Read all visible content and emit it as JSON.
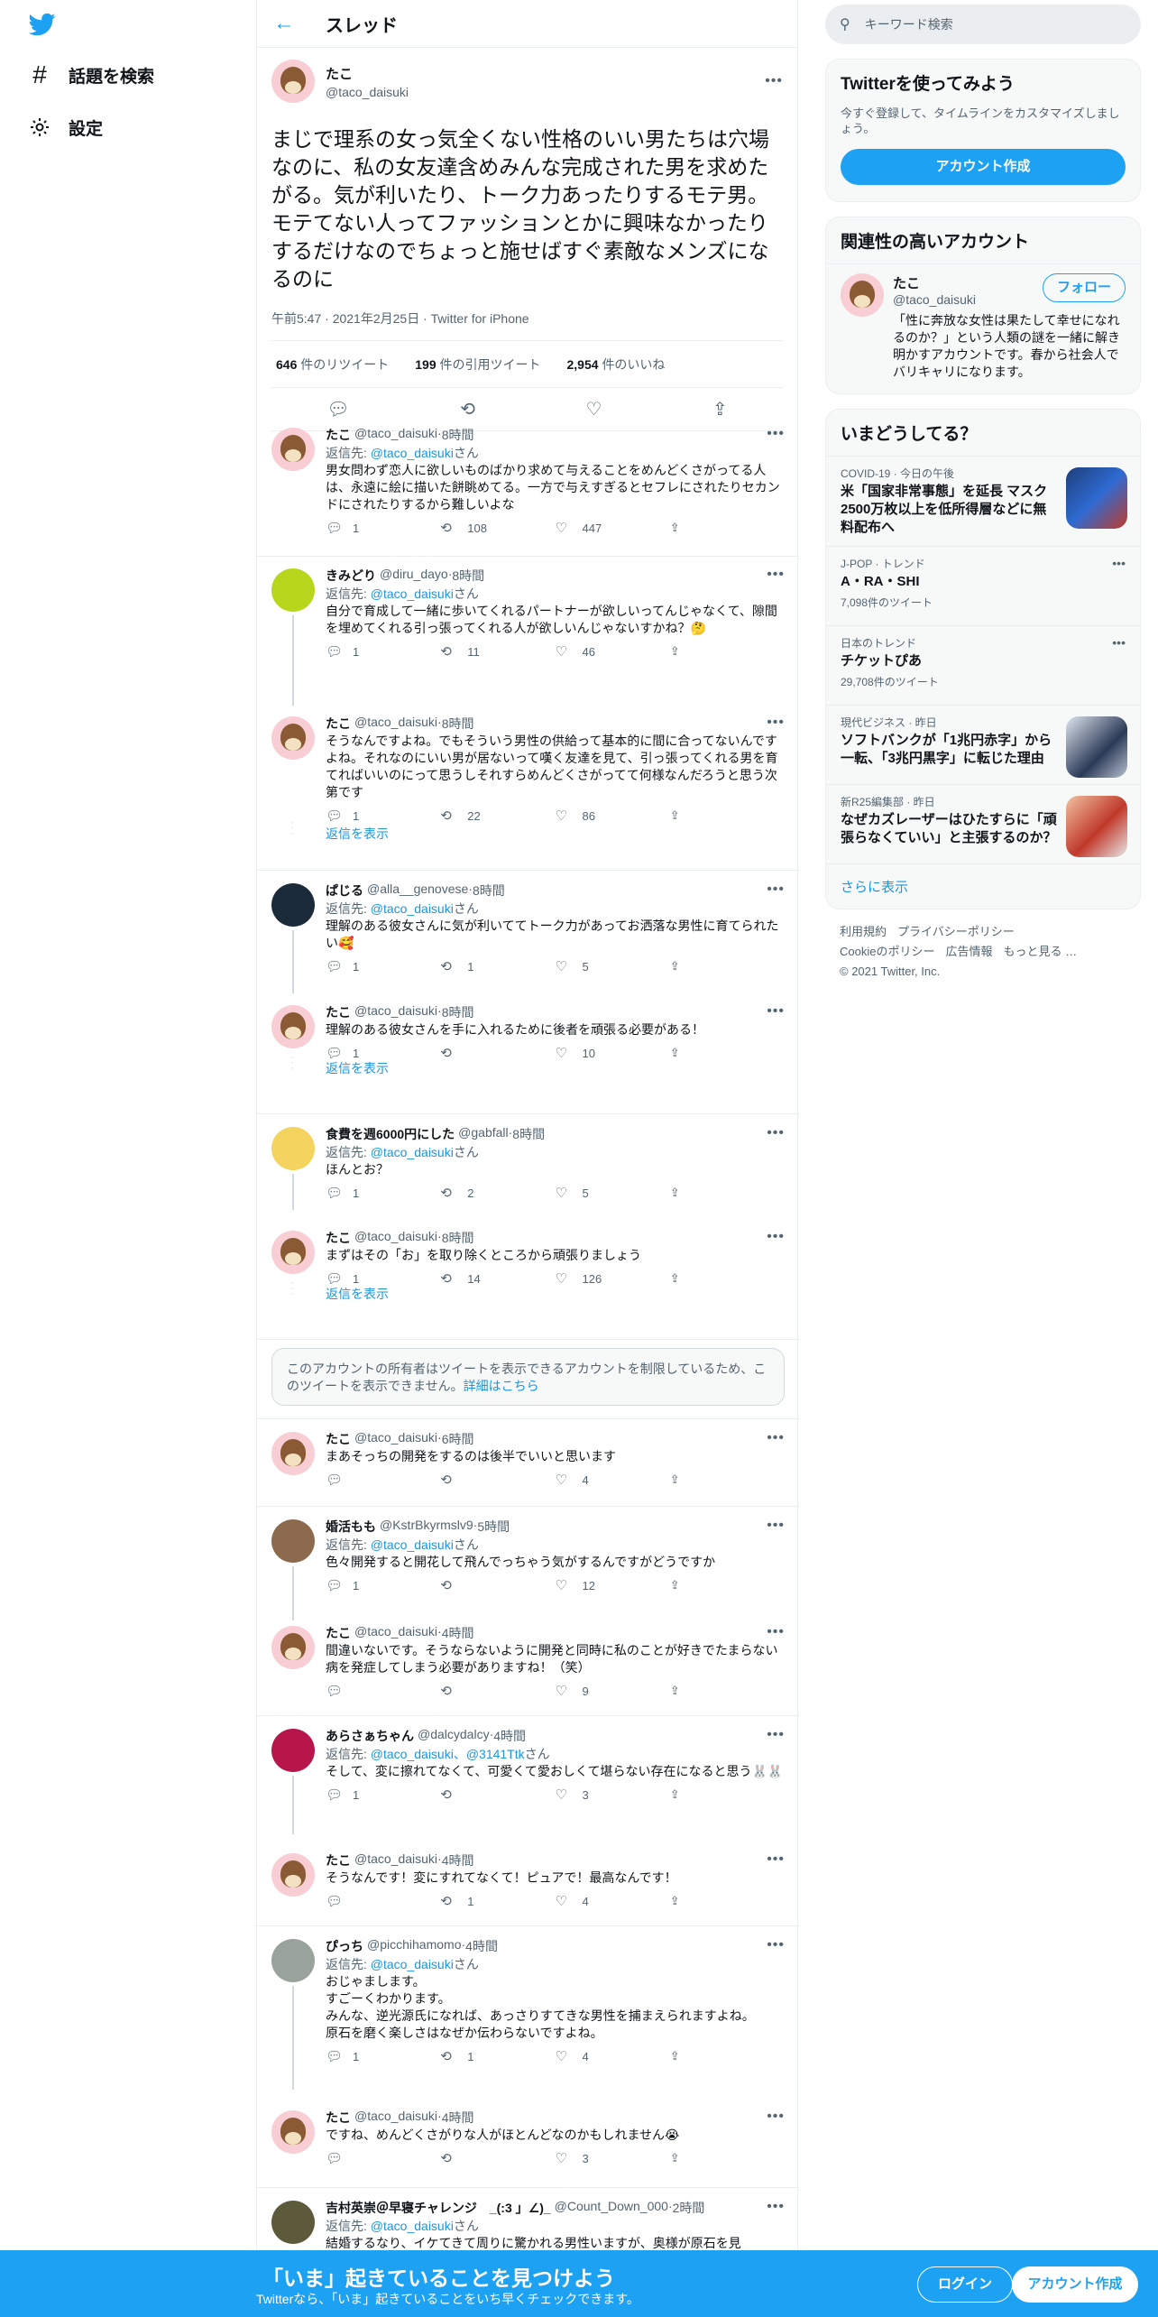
{
  "nav": {
    "explore": "話題を検索",
    "settings": "設定"
  },
  "header": {
    "title": "スレッド"
  },
  "main_tweet": {
    "name": "たこ",
    "handle": "@taco_daisuki",
    "text": "まじで理系の女っ気全くない性格のいい男たちは穴場なのに、私の女友達含めみんな完成された男を求めたがる。気が利いたり、トーク力あったりするモテ男。モテてない人ってファッションとかに興味なかったりするだけなのでちょっと施せばすぐ素敵なメンズになるのに",
    "time": "午前5:47 · 2021年2月25日 · Twitter for iPhone",
    "retweets": "646",
    "retweets_label": "件のリツイート",
    "quotes": "199",
    "quotes_label": "件の引用ツイート",
    "likes": "2,954",
    "likes_label": "件のいいね"
  },
  "replies": [
    {
      "name": "たこ",
      "handle": "@taco_daisuki",
      "time": "8時間",
      "to": "@taco_daisuki",
      "text": "男女問わず恋人に欲しいものばかり求めて与えることをめんどくさがってる人は、永遠に絵に描いた餅眺めてる。一方で与えすぎるとセフレにされたりセカンドにされたりするから難しいよな",
      "reply": "1",
      "rt": "108",
      "like": "447"
    },
    {
      "name": "きみどり",
      "handle": "@diru_dayo",
      "time": "8時間",
      "to": "@taco_daisuki",
      "text": "自分で育成して一緒に歩いてくれるパートナーが欲しいってんじゃなくて、隙間を埋めてくれる引っ張ってくれる人が欲しいんじゃないすかね？🤔",
      "reply": "1",
      "rt": "11",
      "like": "46"
    },
    {
      "name": "たこ",
      "handle": "@taco_daisuki",
      "time": "8時間",
      "to": "",
      "text": "そうなんですよね。でもそういう男性の供給って基本的に間に合ってないんですよね。それなのにいい男が居ないって嘆く友達を見て、引っ張ってくれる男を育てればいいのにって思うしそれすらめんどくさがってて何様なんだろうと思う次第です",
      "reply": "1",
      "rt": "22",
      "like": "86"
    },
    {
      "name": "ぱじる",
      "handle": "@alla__genovese",
      "time": "8時間",
      "to": "@taco_daisuki",
      "text": "理解のある彼女さんに気が利いててトーク力があってお洒落な男性に育てられたい🥰",
      "reply": "1",
      "rt": "1",
      "like": "5"
    },
    {
      "name": "たこ",
      "handle": "@taco_daisuki",
      "time": "8時間",
      "to": "",
      "text": "理解のある彼女さんを手に入れるために後者を頑張る必要がある！",
      "reply": "1",
      "rt": "",
      "like": "10"
    },
    {
      "name": "食費を週6000円にした",
      "handle": "@gabfall",
      "time": "8時間",
      "to": "@taco_daisuki",
      "text": "ほんとお？",
      "reply": "1",
      "rt": "2",
      "like": "5"
    },
    {
      "name": "たこ",
      "handle": "@taco_daisuki",
      "time": "8時間",
      "to": "",
      "text": "まずはその「お」を取り除くところから頑張りましょう",
      "reply": "1",
      "rt": "14",
      "like": "126"
    },
    {
      "name": "たこ",
      "handle": "@taco_daisuki",
      "time": "6時間",
      "to": "",
      "text": "まあそっちの開発をするのは後半でいいと思います",
      "reply": "",
      "rt": "",
      "like": "4"
    },
    {
      "name": "婚活もも",
      "handle": "@KstrBkyrmslv9",
      "time": "5時間",
      "to": "@taco_daisuki",
      "text": "色々開発すると開花して飛んでっちゃう気がするんですがどうですか",
      "reply": "1",
      "rt": "",
      "like": "12"
    },
    {
      "name": "たこ",
      "handle": "@taco_daisuki",
      "time": "4時間",
      "to": "",
      "text": "間違いないです。そうならないように開発と同時に私のことが好きでたまらない病を発症してしまう必要がありますね！（笑）",
      "reply": "",
      "rt": "",
      "like": "9"
    },
    {
      "name": "あらさぁちゃん",
      "handle": "@dalcydalcy",
      "time": "4時間",
      "to": "@taco_daisuki、@3141Ttk",
      "text": "そして、変に擦れてなくて、可愛くて愛おしくて堪らない存在になると思う🐰🐰",
      "reply": "1",
      "rt": "",
      "like": "3"
    },
    {
      "name": "たこ",
      "handle": "@taco_daisuki",
      "time": "4時間",
      "to": "",
      "text": "そうなんです！変にすれてなくて！ピュアで！最高なんです！",
      "reply": "",
      "rt": "1",
      "like": "4"
    },
    {
      "name": "ぴっち",
      "handle": "@picchihamomo",
      "time": "4時間",
      "to": "@taco_daisuki",
      "text": "おじゃまします。\nすごーくわかります。\nみんな、逆光源氏になれば、あっさりすてきな男性を捕まえられますよね。\n原石を磨く楽しさはなぜか伝わらないですよね。",
      "reply": "1",
      "rt": "1",
      "like": "4"
    },
    {
      "name": "たこ",
      "handle": "@taco_daisuki",
      "time": "4時間",
      "to": "",
      "text": "ですね、めんどくさがりな人がほとんどなのかもしれません😭",
      "reply": "",
      "rt": "",
      "like": "3"
    },
    {
      "name": "吉村英崇＠早寝チャレンジ　_(:3 」∠)_",
      "handle": "@Count_Down_000",
      "time": "2時間",
      "to": "@taco_daisuki",
      "text": "結婚するなり、イケてきて周りに驚かれる男性いますが、奥様が原石を見",
      "reply": "",
      "rt": "",
      "like": ""
    }
  ],
  "reply_to_prefix": "返信先: ",
  "reply_to_suffix": "さん",
  "show_replies": "返信を表示",
  "notice": {
    "text": "このアカウントの所有者はツイートを表示できるアカウントを制限しているため、このツイートを表示できません。",
    "link": "詳細はこちら"
  },
  "right": {
    "search_placeholder": "キーワード検索",
    "signup_card": {
      "title": "Twitterを使ってみよう",
      "sub": "今すぐ登録して、タイムラインをカスタマイズしましょう。",
      "button": "アカウント作成"
    },
    "relevant": {
      "title": "関連性の高いアカウント",
      "name": "たこ",
      "handle": "@taco_daisuki",
      "follow": "フォロー",
      "bio": "「性に奔放な女性は果たして幸せになれるのか？」という人類の謎を一緒に解き明かすアカウントです。春から社会人でバリキャリになります。"
    },
    "trends": {
      "title": "いまどうしてる？",
      "items": [
        {
          "meta": "COVID-19 · 今日の午後",
          "title": "米「国家非常事態」を延長 マスク2500万枚以上を低所得層などに無料配布へ",
          "count": ""
        },
        {
          "meta": "J-POP · トレンド",
          "title": "A・RA・SHI",
          "count": "7,098件のツイート"
        },
        {
          "meta": "日本のトレンド",
          "title": "チケットぴあ",
          "count": "29,708件のツイート"
        },
        {
          "meta": "現代ビジネス · 昨日",
          "title": "ソフトバンクが「1兆円赤字」から一転、「3兆円黒字」に転じた理由",
          "count": ""
        },
        {
          "meta": "新R25編集部 · 昨日",
          "title": "なぜカズレーザーはひたすらに「頑張らなくていい」と主張するのか？",
          "count": ""
        }
      ],
      "more": "さらに表示"
    },
    "footer": {
      "terms": "利用規約",
      "privacy": "プライバシーポリシー",
      "cookie": "Cookieのポリシー",
      "ads": "広告情報",
      "more": "もっと見る …",
      "copyright": "© 2021 Twitter, Inc."
    }
  },
  "banner": {
    "title": "「いま」起きていることを見つけよう",
    "sub": "Twitterなら、「いま」起きていることをいち早くチェックできます。",
    "login": "ログイン",
    "signup": "アカウント作成"
  }
}
